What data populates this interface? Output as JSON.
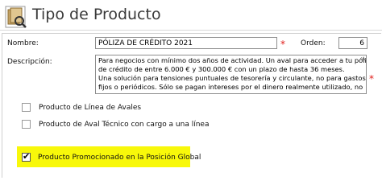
{
  "header": {
    "title": "Tipo de Producto",
    "icon": "document-stack-icon"
  },
  "form": {
    "nombre_label": "Nombre:",
    "nombre_value": "PÓLIZA DE CRÉDITO 2021",
    "required_mark": "*",
    "orden_label": "Orden:",
    "orden_value": "6",
    "descripcion_label": "Descripción:",
    "descripcion_lines": [
      "Para negocios con mínimo dos años de actividad. Un aval para acceder a tu póliza",
      "de crédito de entre 6.000 € y 300.000 € con un plazo de hasta 36 meses.",
      "Una solución para tensiones puntuales de tesorería y circulante, no para gastos",
      "fijos o periódicos. Sólo se pagan intereses por el dinero realmente utilizado, no"
    ]
  },
  "checkboxes": [
    {
      "label": "Producto de Línea de Avales",
      "checked": false
    },
    {
      "label": "Producto de Aval Técnico con cargo a una línea",
      "checked": false
    },
    {
      "label": "Producto Promocionado en la Posición Global",
      "checked": true
    }
  ],
  "colors": {
    "highlight": "#f8f80a",
    "required": "#e0201c"
  }
}
